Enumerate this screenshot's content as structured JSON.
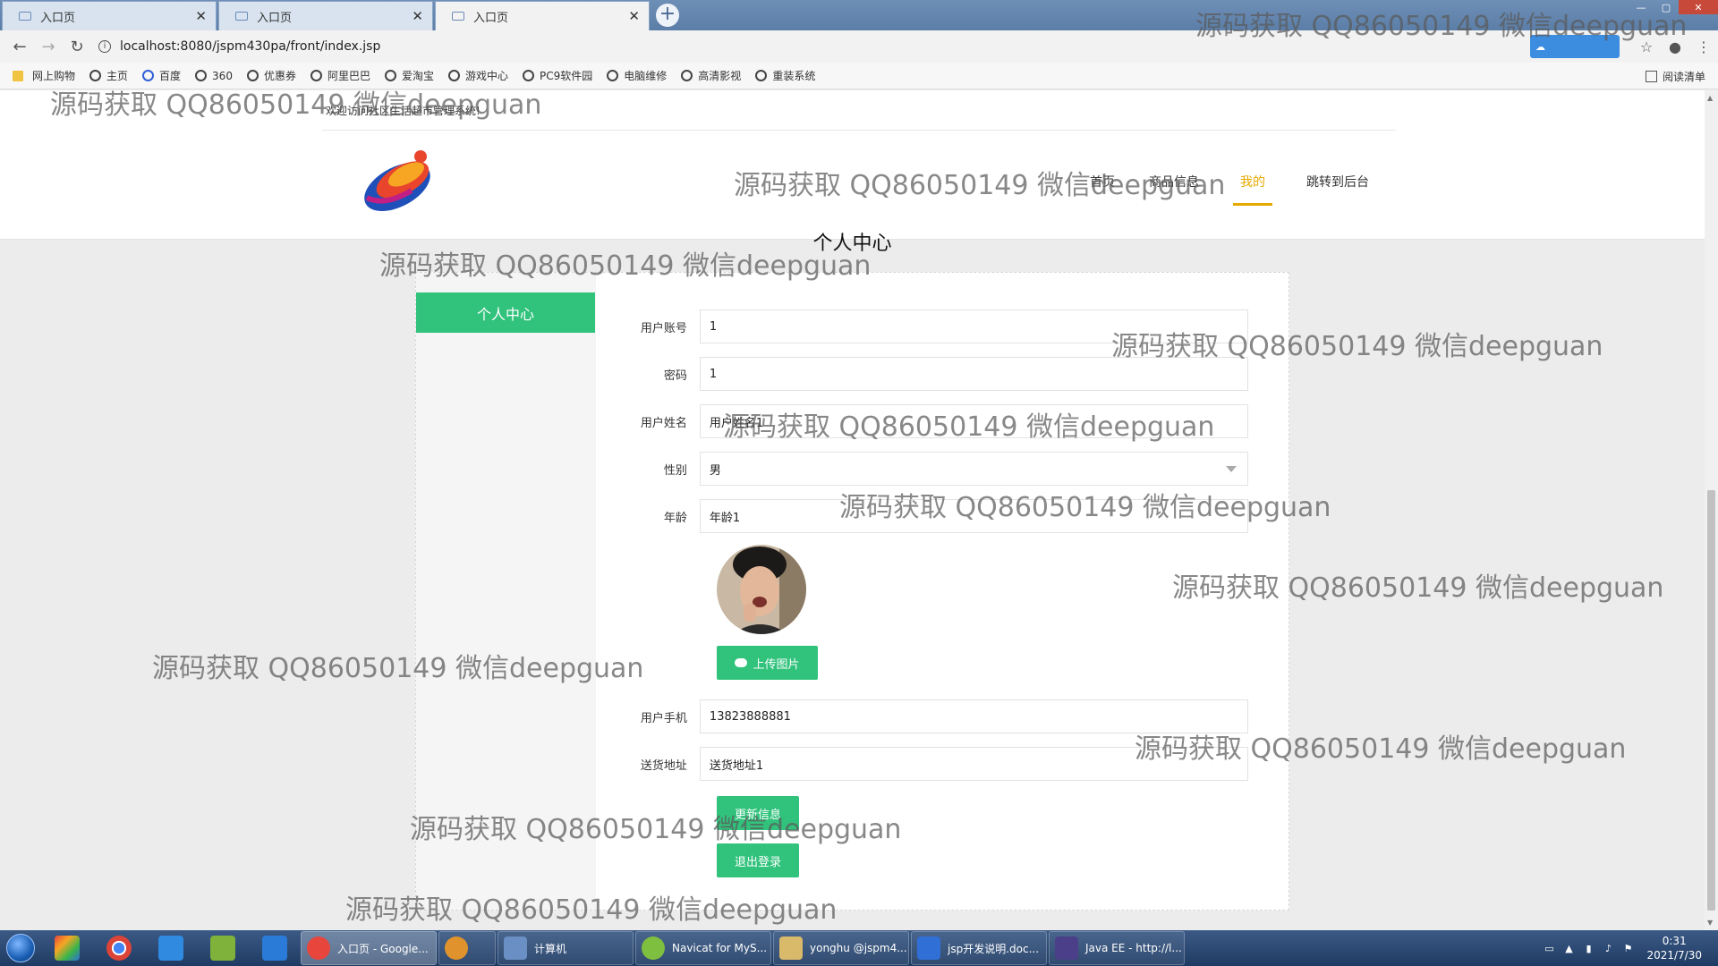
{
  "browser": {
    "tabs": [
      {
        "title": "入口页"
      },
      {
        "title": "入口页"
      },
      {
        "title": "入口页"
      }
    ],
    "url": "localhost:8080/jspm430pa/front/index.jsp",
    "bookmarks": [
      "网上购物",
      "主页",
      "百度",
      "360",
      "优惠券",
      "阿里巴巴",
      "爱淘宝",
      "游戏中心",
      "PC9软件园",
      "电脑维修",
      "高清影视",
      "重装系统"
    ],
    "reading_list": "阅读清单"
  },
  "site": {
    "welcome": "欢迎访问社区生活超市管理系统!",
    "nav": {
      "home": "首页",
      "products": "商品信息",
      "mine": "我的",
      "admin": "跳转到后台"
    },
    "page_title": "个人中心",
    "sidebar": {
      "active": "个人中心"
    }
  },
  "form": {
    "account": {
      "label": "用户账号",
      "value": "1"
    },
    "password": {
      "label": "密码",
      "value": "1"
    },
    "name": {
      "label": "用户姓名",
      "value": "用户姓名1"
    },
    "gender": {
      "label": "性别",
      "value": "男"
    },
    "age": {
      "label": "年龄",
      "value": "年龄1"
    },
    "upload_label": "上传图片",
    "phone": {
      "label": "用户手机",
      "value": "13823888881"
    },
    "address": {
      "label": "送货地址",
      "value": "送货地址1"
    },
    "update_label": "更新信息",
    "logout_label": "退出登录"
  },
  "taskbar": {
    "tasks": [
      {
        "label": "入口页 - Google...",
        "color": "#e8453c"
      },
      {
        "label": "",
        "color": "#e0932c"
      },
      {
        "label": "计算机",
        "color": "#6a8fc4"
      },
      {
        "label": "Navicat for MyS...",
        "color": "#7fbf3f"
      },
      {
        "label": "yonghu @jspm4...",
        "color": "#d9b96a"
      },
      {
        "label": "jsp开发说明.doc...",
        "color": "#2f6fd6"
      },
      {
        "label": "Java EE - http://l...",
        "color": "#4b3f8a"
      }
    ],
    "clock_time": "0:31",
    "clock_date": "2021/7/30"
  },
  "watermark": "源码获取 QQ86050149 微信deepguan"
}
